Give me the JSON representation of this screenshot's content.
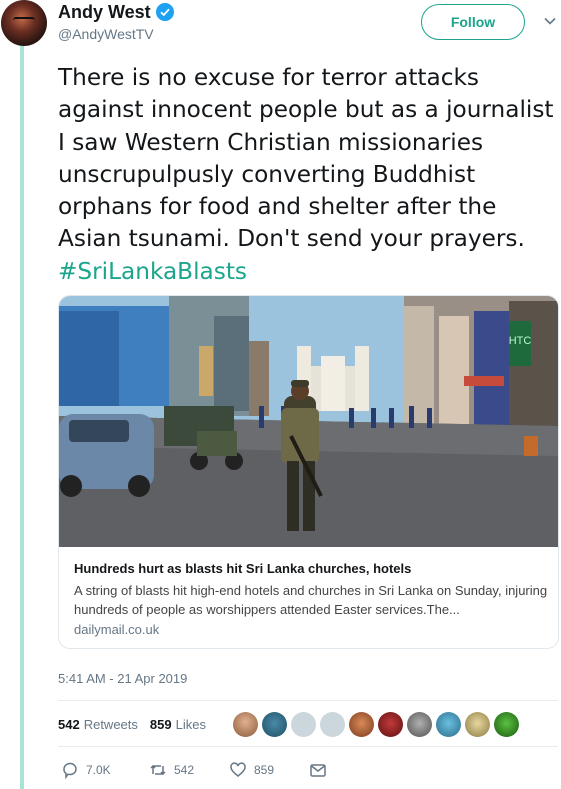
{
  "user": {
    "name": "Andy West",
    "handle": "@AndyWestTV",
    "follow_label": "Follow"
  },
  "tweet": {
    "text": "There is no excuse for terror attacks against innocent people but as a journalist I saw Western Christian missionaries unscrupulpusly converting Buddhist orphans for food and shelter after the Asian tsunami. Don't send your prayers. ",
    "hashtag": "#SriLankaBlasts",
    "timestamp": "5:41 AM - 21 Apr 2019"
  },
  "card": {
    "title": "Hundreds hurt as blasts hit Sri Lanka churches, hotels",
    "description": "A string of blasts hit high-end hotels and churches in Sri Lanka on Sunday, injuring hundreds of people as worshippers attended Easter services.The...",
    "domain": "dailymail.co.uk",
    "shop_sign": "HTC"
  },
  "stats": {
    "retweets_count": "542",
    "retweets_label": "Retweets",
    "likes_count": "859",
    "likes_label": "Likes"
  },
  "actions": {
    "replies": "7.0K",
    "retweets": "542",
    "likes": "859"
  },
  "colors": {
    "accent": "#1aa58c",
    "thread_line": "#a7e3d7",
    "verified": "#1da1f2"
  }
}
